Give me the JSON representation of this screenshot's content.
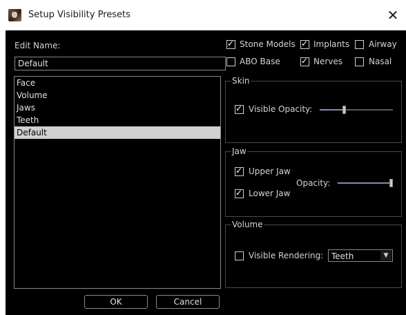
{
  "window": {
    "title": "Setup Visibility Presets",
    "close_glyph": "✕",
    "icon": "app-skull-icon"
  },
  "edit": {
    "label": "Edit Name:",
    "value": "Default"
  },
  "presets": {
    "items": [
      {
        "label": "Face"
      },
      {
        "label": "Volume"
      },
      {
        "label": "Jaws"
      },
      {
        "label": "Teeth"
      },
      {
        "label": "Default",
        "selected": true
      }
    ]
  },
  "buttons": {
    "ok": "OK",
    "cancel": "Cancel"
  },
  "checks": {
    "stone_models": {
      "label": "Stone Models",
      "checked": true
    },
    "implants": {
      "label": "Implants",
      "checked": true
    },
    "airway": {
      "label": "Airway",
      "checked": false
    },
    "abo_base": {
      "label": "ABO Base",
      "checked": false
    },
    "nerves": {
      "label": "Nerves",
      "checked": true
    },
    "nasal": {
      "label": "Nasal",
      "checked": false
    }
  },
  "skin": {
    "title": "Skin",
    "visible_label": "Visible",
    "visible_checked": true,
    "opacity_label": "Opacity:",
    "opacity_fraction": 0.33
  },
  "jaw": {
    "title": "Jaw",
    "upper_label": "Upper Jaw",
    "upper_checked": true,
    "lower_label": "Lower Jaw",
    "lower_checked": true,
    "opacity_label": "Opacity:",
    "opacity_fraction": 1.0
  },
  "volume": {
    "title": "Volume",
    "visible_label": "Visible",
    "visible_checked": false,
    "rendering_label": "Rendering:",
    "rendering_value": "Teeth"
  },
  "colors": {
    "background": "#000000",
    "selection": "#d0d0d0",
    "slider_fill": "#8e87b2"
  }
}
